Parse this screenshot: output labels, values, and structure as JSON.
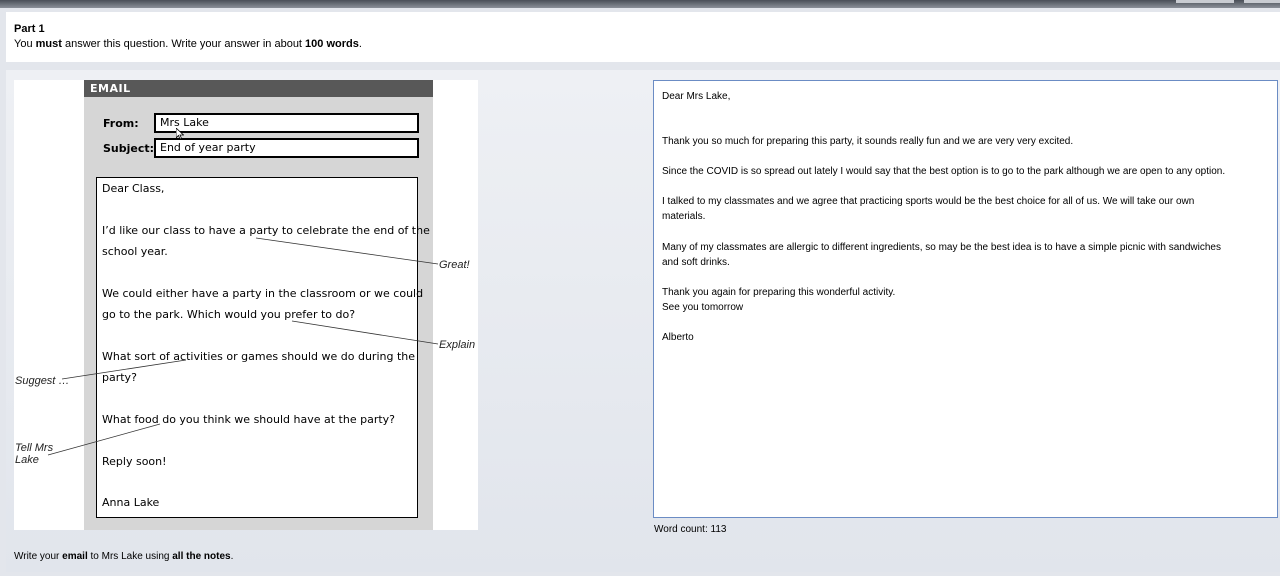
{
  "header": {
    "part_title": "Part 1",
    "instruction": {
      "t1": "You ",
      "must": "must",
      "t2": " answer this question. Write your answer in about ",
      "words": "100 words",
      "t3": "."
    }
  },
  "email": {
    "header_label": "EMAIL",
    "from_label": "From:",
    "from_value": "Mrs Lake",
    "subject_label": "Subject:",
    "subject_value": "End of year party",
    "body": {
      "greeting": "Dear Class,",
      "p1_l1": "I’d like our class to have a party to celebrate the end of the",
      "p1_l2": "school year.",
      "p2_l1": "We could either have a party in the classroom or we could",
      "p2_l2": "go to the park. Which would you prefer to do?",
      "p3_l1": "What sort of activities or games should we do during the",
      "p3_l2": "party?",
      "p4_l1": "What food do you think we should have at the party?",
      "p5": "Reply soon!",
      "sign": "Anna Lake"
    }
  },
  "notes": {
    "great": "Great!",
    "explain": "Explain",
    "suggest": "Suggest …",
    "tell_l1": "Tell Mrs",
    "tell_l2": "Lake"
  },
  "answer": {
    "l1": "Dear Mrs Lake,",
    "l2": "Thank you so much for preparing this party, it sounds really fun and we are very very excited.",
    "l3": "Since the COVID is so spread out lately I would say that the best option is to go to the park although we are open to any option.",
    "l4": "I talked to my classmates and we agree that practicing sports would be the best choice for all of us. We will take our own",
    "l5": "materials.",
    "l6": "Many of my classmates are allergic to different ingredients, so may be the best idea is to have a simple picnic with sandwiches",
    "l7": "and soft drinks.",
    "l8": "Thank you again for preparing this wonderful activity.",
    "l9": "See you tomorrow",
    "l10": "Alberto"
  },
  "word_count": {
    "label": "Word count:",
    "value": "113"
  },
  "footer": {
    "t1": "Write your ",
    "email": "email",
    "t2": " to Mrs Lake using ",
    "notes": "all the notes",
    "t3": "."
  }
}
